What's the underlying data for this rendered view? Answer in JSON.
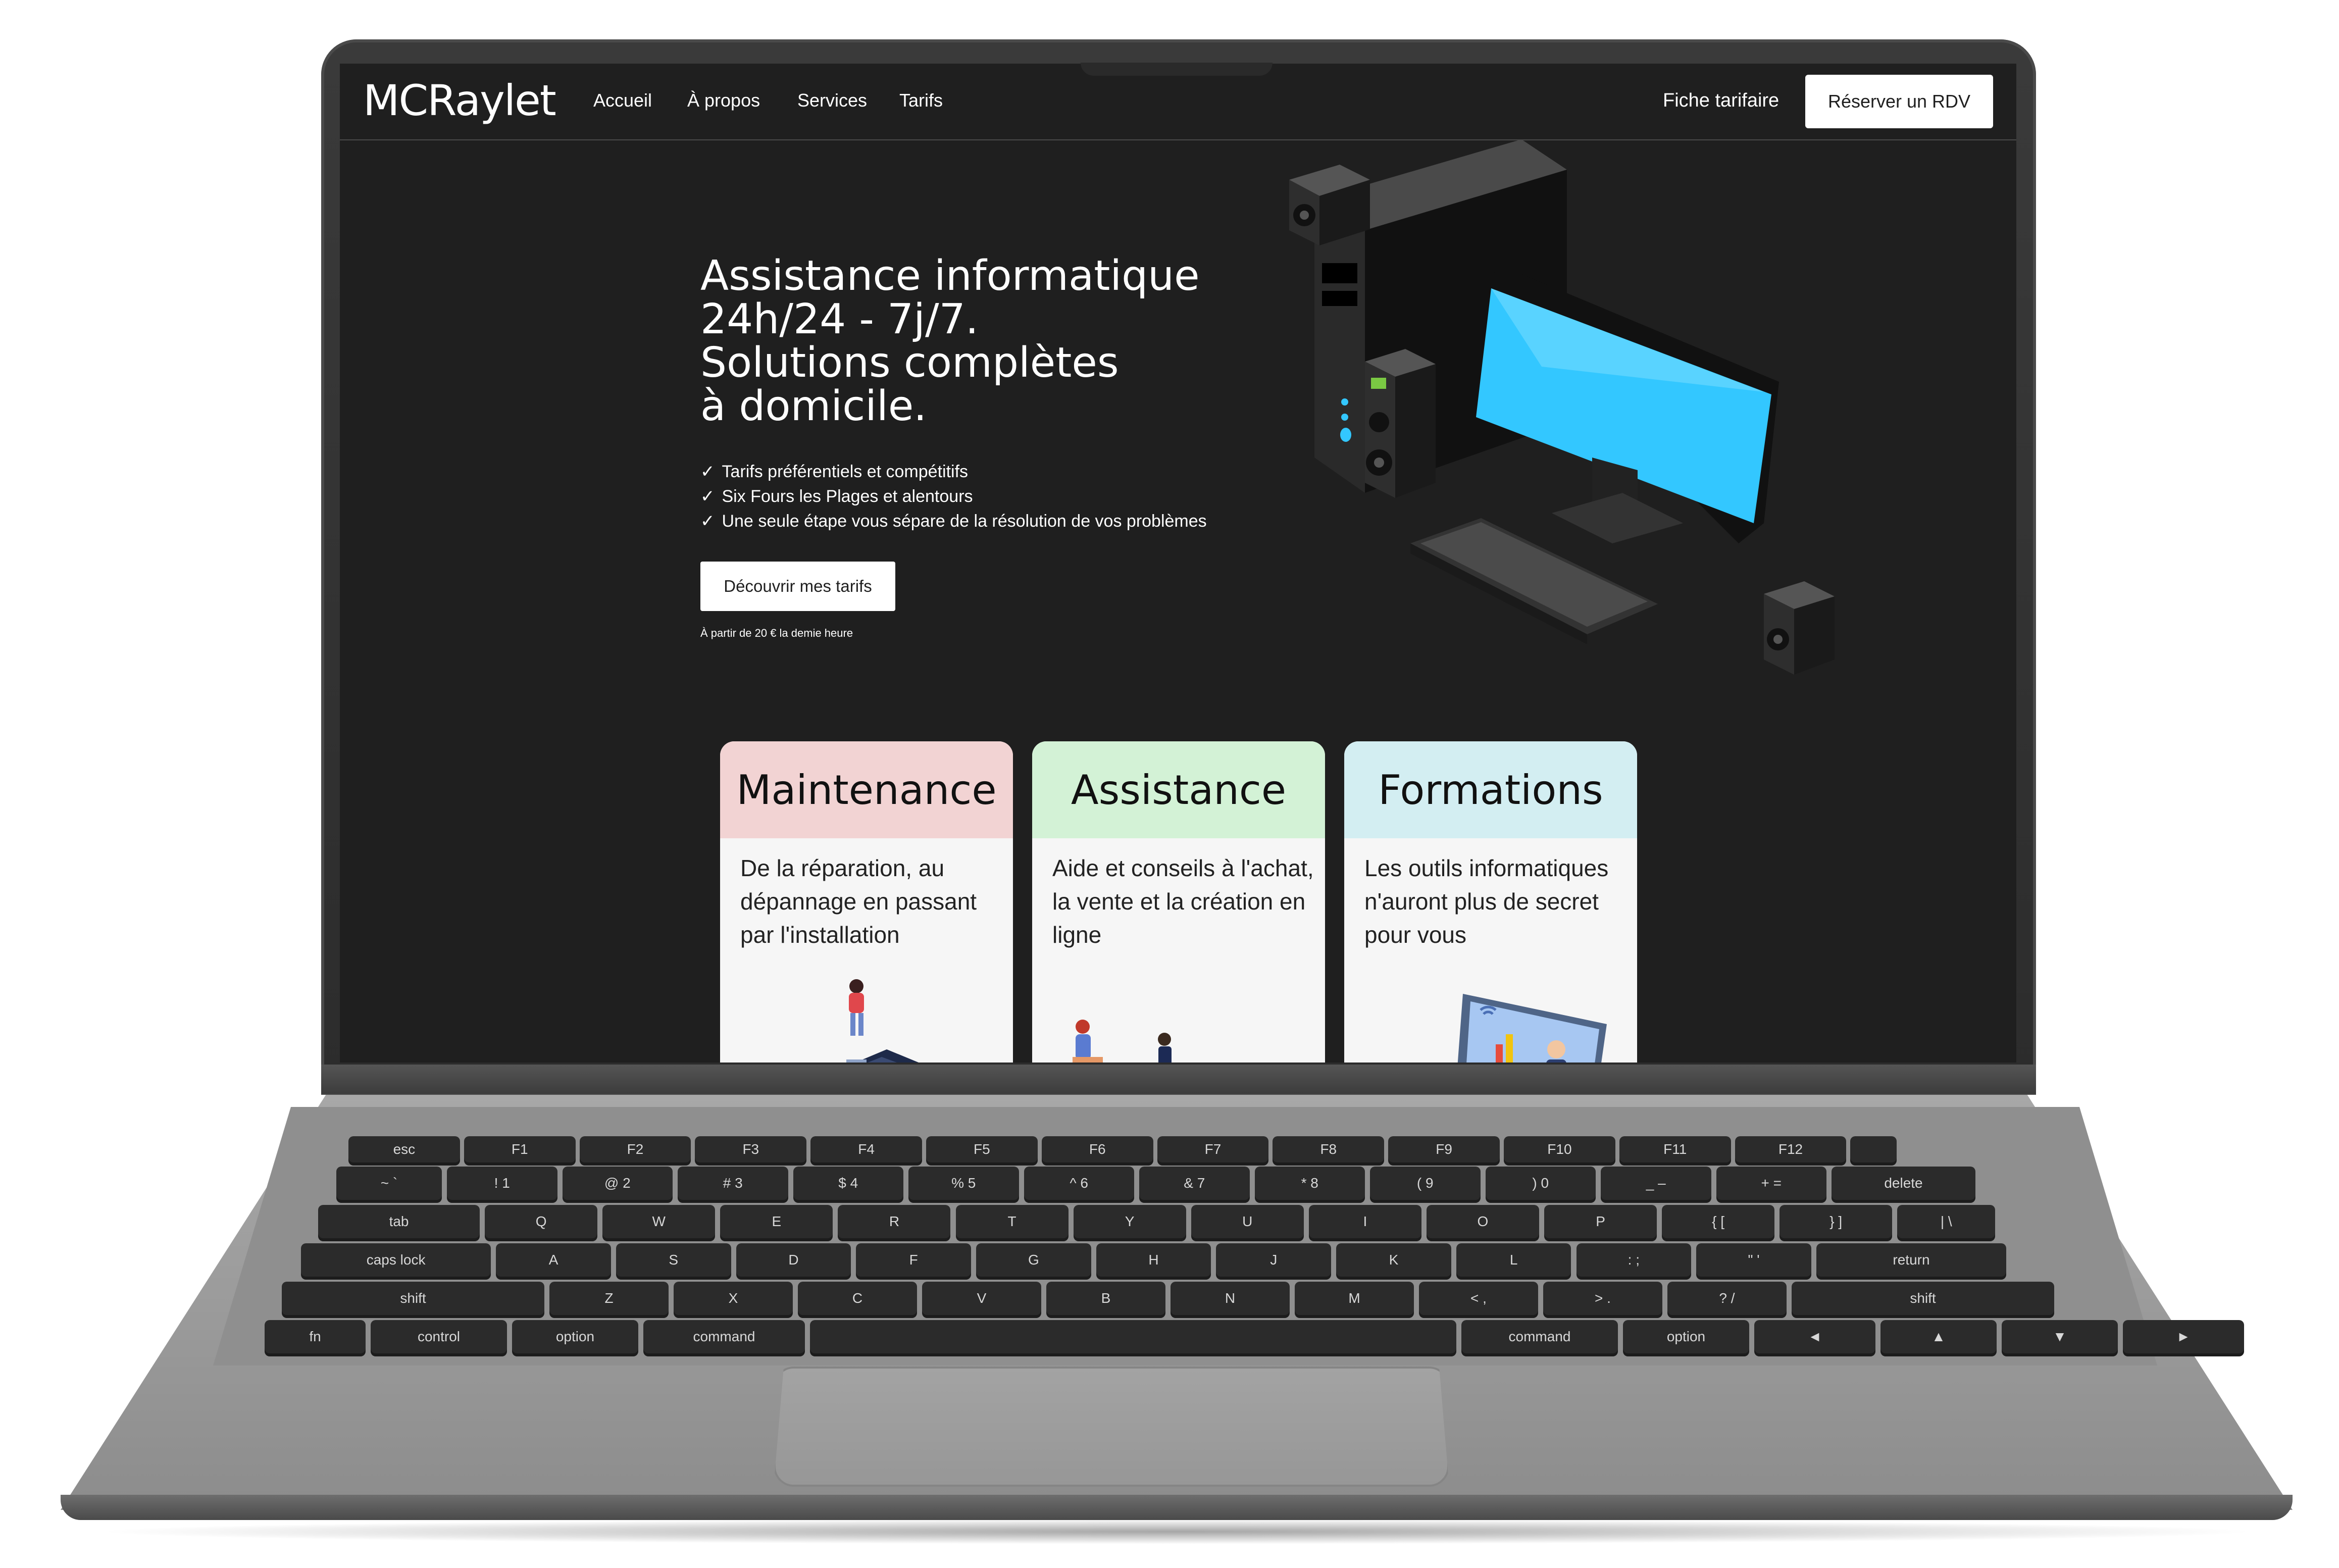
{
  "brand": {
    "logo": "MCRaylet"
  },
  "nav": {
    "links": [
      "Accueil",
      "À propos",
      "Services",
      "Tarifs"
    ],
    "fiche": "Fiche tarifaire",
    "rdv": "Réserver un RDV"
  },
  "hero": {
    "title_lines": [
      "Assistance informatique",
      "24h/24 - 7j/7.",
      "Solutions complètes",
      "à domicile."
    ],
    "check_mark": "✓",
    "checks": [
      "Tarifs préférentiels et compétitifs",
      "Six Fours les Plages et alentours",
      "Une seule étape vous sépare de la résolution de vos problèmes"
    ],
    "cta": "Découvrir mes tarifs",
    "price_note": "À partir de 20 € la demie heure"
  },
  "cards": [
    {
      "title": "Maintenance",
      "text": "De la réparation, au dépannage en passant par l'installation",
      "color": "#f2d3d3"
    },
    {
      "title": "Assistance",
      "text": "Aide et conseils à l'achat, la vente et la création en ligne",
      "color": "#d3f2d6"
    },
    {
      "title": "Formations",
      "text": "Les outils informatiques n'auront plus de secret pour vous",
      "color": "#d3eef2"
    }
  ],
  "keyboard": {
    "fn_row": [
      "esc",
      "F1",
      "F2",
      "F3",
      "F4",
      "F5",
      "F6",
      "F7",
      "F8",
      "F9",
      "F10",
      "F11",
      "F12",
      ""
    ],
    "num_row": [
      "~\n`",
      "!\n1",
      "@\n2",
      "#\n3",
      "$\n4",
      "%\n5",
      "^\n6",
      "&\n7",
      "*\n8",
      "(\n9",
      ")\n0",
      "_\n–",
      "+\n=",
      "delete"
    ],
    "q_row": [
      "tab",
      "Q",
      "W",
      "E",
      "R",
      "T",
      "Y",
      "U",
      "I",
      "O",
      "P",
      "{\n[",
      "}\n]",
      "|\n\\"
    ],
    "a_row": [
      "caps lock",
      "A",
      "S",
      "D",
      "F",
      "G",
      "H",
      "J",
      "K",
      "L",
      ":\n;",
      "\"\n'",
      "return"
    ],
    "z_row": [
      "shift",
      "Z",
      "X",
      "C",
      "V",
      "B",
      "N",
      "M",
      "<\n,",
      ">\n.",
      "?\n/",
      "shift"
    ],
    "bottom_row": [
      "fn",
      "control",
      "option",
      "command",
      "",
      "command",
      "option",
      "◄",
      "▲",
      "▼",
      "►"
    ]
  },
  "colors": {
    "screen_bg": "#1f1f1f",
    "monitor_screen": "#33c7ff"
  }
}
